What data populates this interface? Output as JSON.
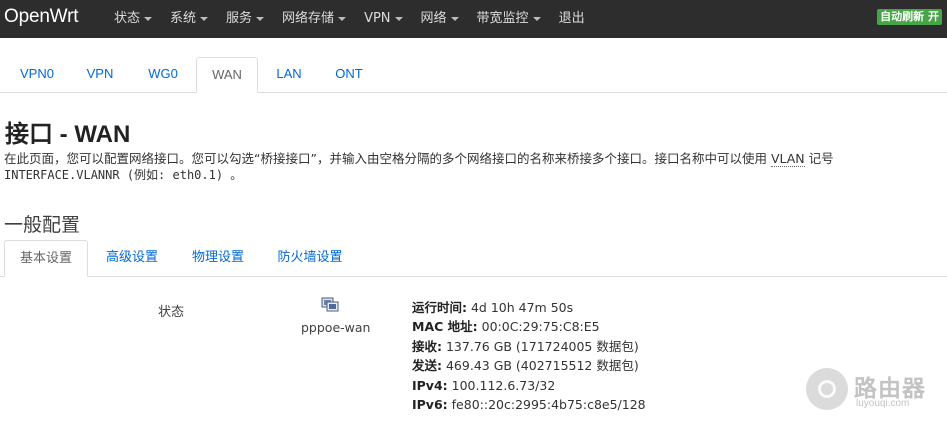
{
  "navbar": {
    "brand": "OpenWrt",
    "menu": [
      {
        "label": "状态",
        "dropdown": true
      },
      {
        "label": "系统",
        "dropdown": true
      },
      {
        "label": "服务",
        "dropdown": true
      },
      {
        "label": "网络存储",
        "dropdown": true
      },
      {
        "label": "VPN",
        "dropdown": true
      },
      {
        "label": "网络",
        "dropdown": true
      },
      {
        "label": "带宽监控",
        "dropdown": true
      },
      {
        "label": "退出",
        "dropdown": false
      }
    ],
    "autorefresh": "自动刷新 开"
  },
  "interface_tabs": [
    "VPN0",
    "VPN",
    "WG0",
    "WAN",
    "LAN",
    "ONT"
  ],
  "active_interface": "WAN",
  "page": {
    "title": "接口 - WAN",
    "desc_part1": "在此页面，您可以配置网络接口。您可以勾选“桥接接口”，并输入由空格分隔的多个网络接口的名称来桥接多个接口。接口名称中可以使用 ",
    "desc_abbr": "VLAN",
    "desc_part2": " 记号",
    "desc_line2": "INTERFACE.VLANNR (例如: eth0.1) 。"
  },
  "section": {
    "title": "一般配置",
    "tabs": [
      "基本设置",
      "高级设置",
      "物理设置",
      "防火墙设置"
    ],
    "active_tab": "基本设置"
  },
  "status": {
    "label": "状态",
    "icon": "ethernet-icon",
    "interface": "pppoe-wan",
    "rows": [
      {
        "key": "运行时间:",
        "value": "4d 10h 47m 50s"
      },
      {
        "key": "MAC 地址:",
        "value": "00:0C:29:75:C8:E5"
      },
      {
        "key": "接收:",
        "value": "137.76 GB (171724005 数据包)"
      },
      {
        "key": "发送:",
        "value": "469.43 GB (402715512 数据包)"
      },
      {
        "key": "IPv4:",
        "value": "100.112.6.73/32"
      },
      {
        "key": "IPv6:",
        "value": "fe80::20c:2995:4b75:c8e5/128"
      }
    ]
  },
  "watermark": {
    "text": "路由器",
    "sub": "luyouqi.com"
  },
  "colors": {
    "navbar_bg": "#2d2d2d",
    "link": "#0069d6",
    "autorefresh_bg": "#46a546"
  }
}
